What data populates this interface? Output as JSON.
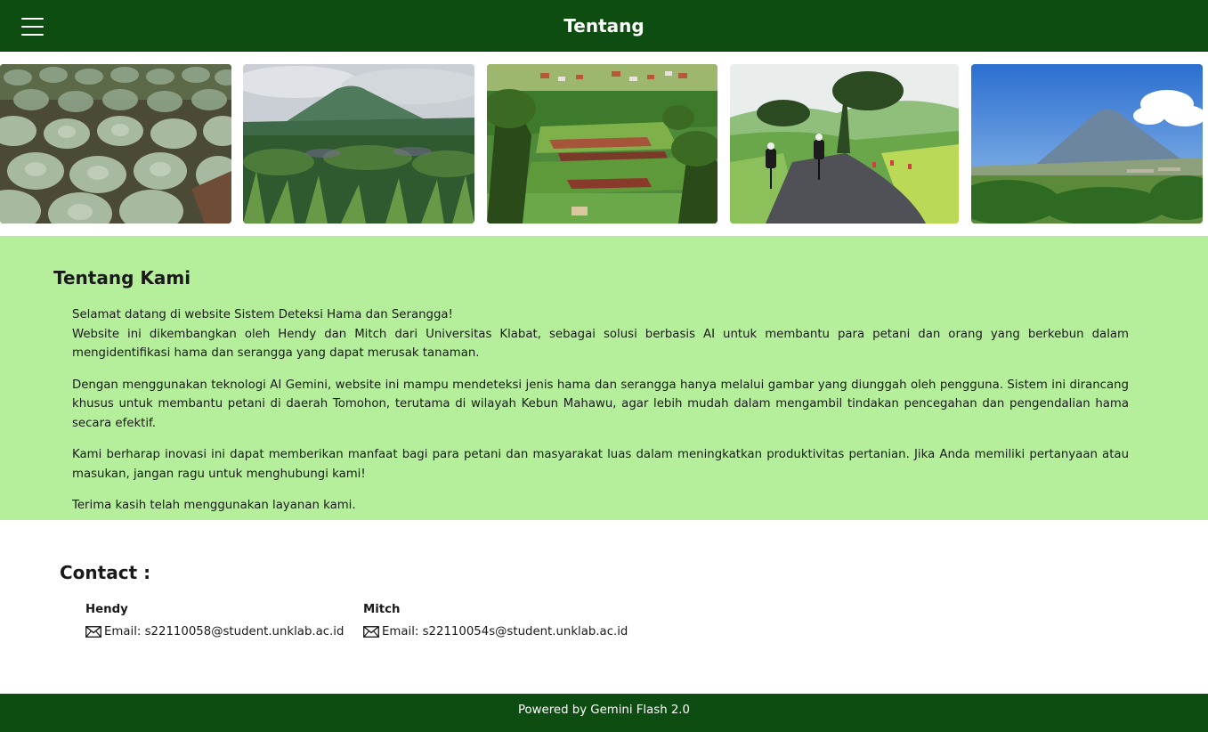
{
  "header": {
    "title": "Tentang",
    "menu_icon": "hamburger-menu-icon",
    "background": "#0d4d12"
  },
  "gallery": {
    "images": [
      {
        "alt": "cabbage-field"
      },
      {
        "alt": "mountain-vegetation"
      },
      {
        "alt": "terraced-farmland"
      },
      {
        "alt": "cyclists-road"
      },
      {
        "alt": "mountain-valley"
      }
    ]
  },
  "about": {
    "heading": "Tentang Kami",
    "background": "#b5ef9b",
    "welcome": "Selamat datang di website Sistem Deteksi Hama dan Serangga!",
    "paragraph1": "Website ini dikembangkan oleh Hendy dan Mitch dari Universitas Klabat, sebagai solusi berbasis AI untuk membantu para petani dan orang yang berkebun dalam mengidentifikasi hama dan serangga yang dapat merusak tanaman.",
    "paragraph2": "Dengan menggunakan teknologi AI Gemini, website ini mampu mendeteksi jenis hama dan serangga hanya melalui gambar yang diunggah oleh pengguna. Sistem ini dirancang khusus untuk membantu petani di daerah Tomohon, terutama di wilayah Kebun Mahawu, agar lebih mudah dalam mengambil tindakan pencegahan dan pengendalian hama secara efektif.",
    "paragraph3": "Kami berharap inovasi ini dapat memberikan manfaat bagi para petani dan masyarakat luas dalam meningkatkan produktivitas pertanian. Jika Anda memiliki pertanyaan atau masukan, jangan ragu untuk menghubungi kami!",
    "paragraph4": "Terima kasih telah menggunakan layanan kami."
  },
  "contact": {
    "heading": "Contact :",
    "people": [
      {
        "name": "Hendy",
        "email": "Email: s22110058@student.unklab.ac.id",
        "icon": "envelope-icon"
      },
      {
        "name": "Mitch",
        "email": "Email: s22110054s@student.unklab.ac.id",
        "icon": "envelope-icon"
      }
    ]
  },
  "footer": {
    "text": "Powered by Gemini Flash 2.0"
  }
}
